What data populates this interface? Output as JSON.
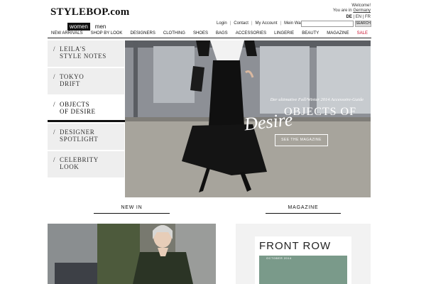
{
  "header": {
    "logo": "STYLEBOP.com",
    "gender_tabs": [
      "women",
      "men"
    ],
    "welcome_line1": "Welcome!",
    "welcome_line2_prefix": "You are in",
    "welcome_country": "Germany",
    "languages": [
      "DE",
      "EN",
      "FR"
    ],
    "utility_links": [
      "Login",
      "Contact",
      "My Account",
      "Mein Warenkorb"
    ],
    "search_placeholder": "",
    "search_button": "SEARCH"
  },
  "nav": {
    "items": [
      "NEW ARRIVALS",
      "SHOP BY LOOK",
      "DESIGNERS",
      "CLOTHING",
      "SHOES",
      "BAGS",
      "ACCESSORIES",
      "LINGERIE",
      "BEAUTY",
      "MAGAZINE",
      "SALE"
    ],
    "sale_color": "#c8102e"
  },
  "sidebar": {
    "items": [
      {
        "line1": "LEILA'S",
        "line2": "STYLE NOTES"
      },
      {
        "line1": "TOKYO",
        "line2": "DRIFT"
      },
      {
        "line1": "OBJECTS",
        "line2": "OF DESIRE"
      },
      {
        "line1": "DESIGNER",
        "line2": "SPOTLIGHT"
      },
      {
        "line1": "CELEBRITY",
        "line2": "LOOK"
      }
    ],
    "active_index": 2
  },
  "hero": {
    "subtitle": "Der ultimative Fall/Winter 2014 Accessoire-Guide",
    "title": "OBJECTS OF",
    "script": "Desire",
    "button": "SEE THE MAGAZINE"
  },
  "sections": {
    "new_in": "NEW IN",
    "magazine": "MAGAZINE"
  },
  "magazine_cover": {
    "title": "FRONT ROW",
    "date": "OCTOBER 2014"
  }
}
